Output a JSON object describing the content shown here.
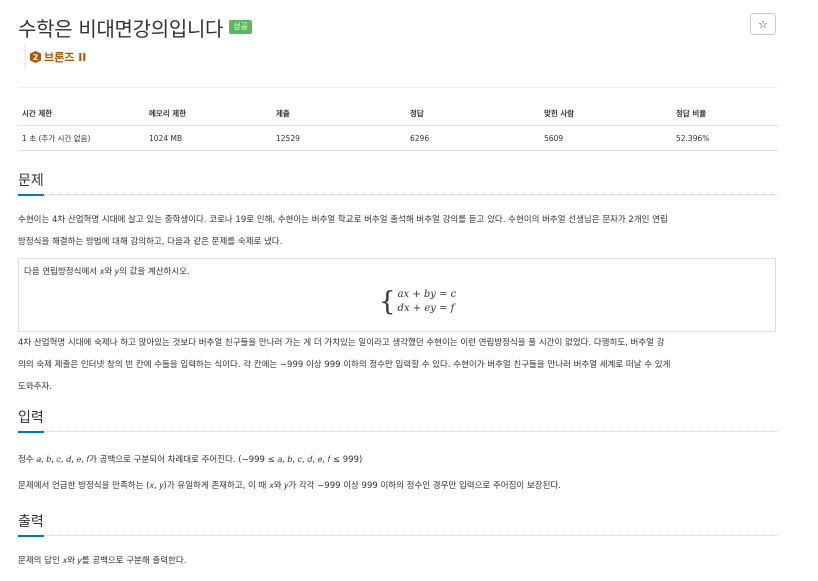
{
  "problem": {
    "title": "수학은 비대면강의입니다",
    "status_badge": "성공",
    "star_button": "☆",
    "tier": {
      "number": "2",
      "label": "브론즈 II",
      "color": "#ad5600"
    }
  },
  "info_table": {
    "headers": [
      "시간 제한",
      "메모리 제한",
      "제출",
      "정답",
      "맞힌 사람",
      "정답 비율"
    ],
    "values": [
      "1 초 (추가 시간 없음)",
      "1024 MB",
      "12529",
      "6296",
      "5609",
      "52.396%"
    ]
  },
  "sections": {
    "problem_label": "문제",
    "input_label": "입력",
    "output_label": "출력"
  },
  "problem_text": {
    "para1_line1": "수현이는 4차 산업혁명 시대에 살고 있는 중학생이다. 코로나 19로 인해, 수현이는 버추얼 학교로 버추얼 출석해 버추얼 강의를 듣고 있다. 수현이의 버추얼 선생님은 문자가 2개인 연립",
    "para1_line2": "방정식을 해결하는 방법에 대해 강의하고, 다음과 같은 문제를 숙제로 냈다.",
    "box_intro": "다음 연립방정식에서 𝑥와 𝑦의 값을 계산하시오.",
    "eq1": "ax + by = c",
    "eq2": "dx + ey = f",
    "para2_line1": "4차 산업혁명 시대에 숙제나 하고 앉아있는 것보다 버추얼 친구들을 만나러 가는 게 더 가치있는 일이라고 생각했던 수현이는 이런 연립방정식을 풀 시간이 없었다. 다행히도, 버추얼 강",
    "para2_line2": "의의 숙제 제출은 인터넷 창의 빈 칸에 수들을 입력하는 식이다. 각 칸에는 −999 이상 999 이하의 정수만 입력할 수 있다. 수현이가 버추얼 친구들을 만나러 버추얼 세계로 떠날 수 있게",
    "para2_line3": "도와주자."
  },
  "input_text": {
    "line1": "정수 𝑎, 𝑏, 𝑐, 𝑑, 𝑒, 𝑓가 공백으로 구분되어 차례대로 주어진다. (−999 ≤ 𝑎, 𝑏, 𝑐, 𝑑, 𝑒, 𝑓 ≤ 999)",
    "line2": "문제에서 언급한 방정식을 만족하는 (𝑥, 𝑦)가 유일하게 존재하고, 이 때 𝑥와 𝑦가 각각 −999 이상 999 이하의 정수인 경우만 입력으로 주어짐이 보장된다."
  },
  "output_text": {
    "line1": "문제의 답인 𝑥와 𝑦를 공백으로 구분해 출력한다."
  }
}
